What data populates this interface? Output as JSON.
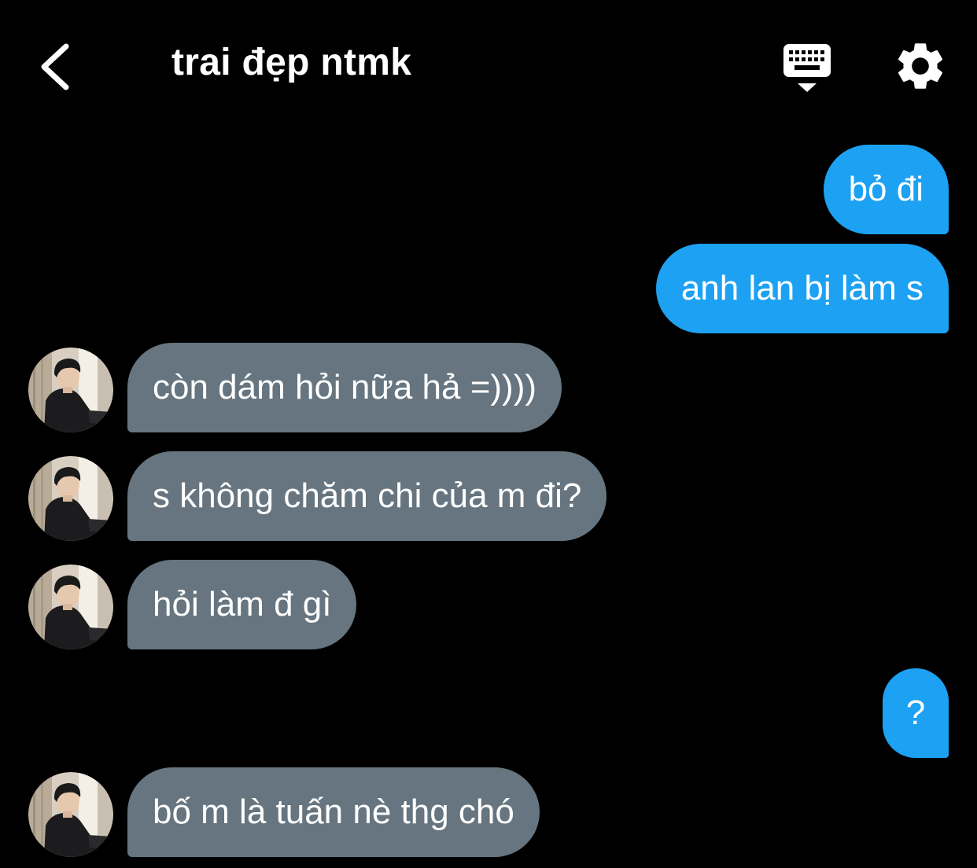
{
  "header": {
    "title": "trai đẹp ntmk",
    "back_icon": "chevron-left-icon",
    "keyboard_icon": "keyboard-icon",
    "settings_icon": "gear-icon"
  },
  "colors": {
    "background": "#000000",
    "outgoing_bubble": "#1da1f2",
    "incoming_bubble": "#66757f",
    "text": "#ffffff"
  },
  "messages": [
    {
      "direction": "outgoing",
      "text": "bỏ đi"
    },
    {
      "direction": "outgoing",
      "text": "anh lan bị làm s"
    },
    {
      "direction": "incoming",
      "text": "còn dám hỏi nữa hả =))))"
    },
    {
      "direction": "incoming",
      "text": "s không chăm chi của m đi?"
    },
    {
      "direction": "incoming",
      "text": "hỏi làm đ gì"
    },
    {
      "direction": "outgoing",
      "text": "?"
    },
    {
      "direction": "incoming",
      "text": "bố m là tuấn nè thg chó"
    }
  ]
}
